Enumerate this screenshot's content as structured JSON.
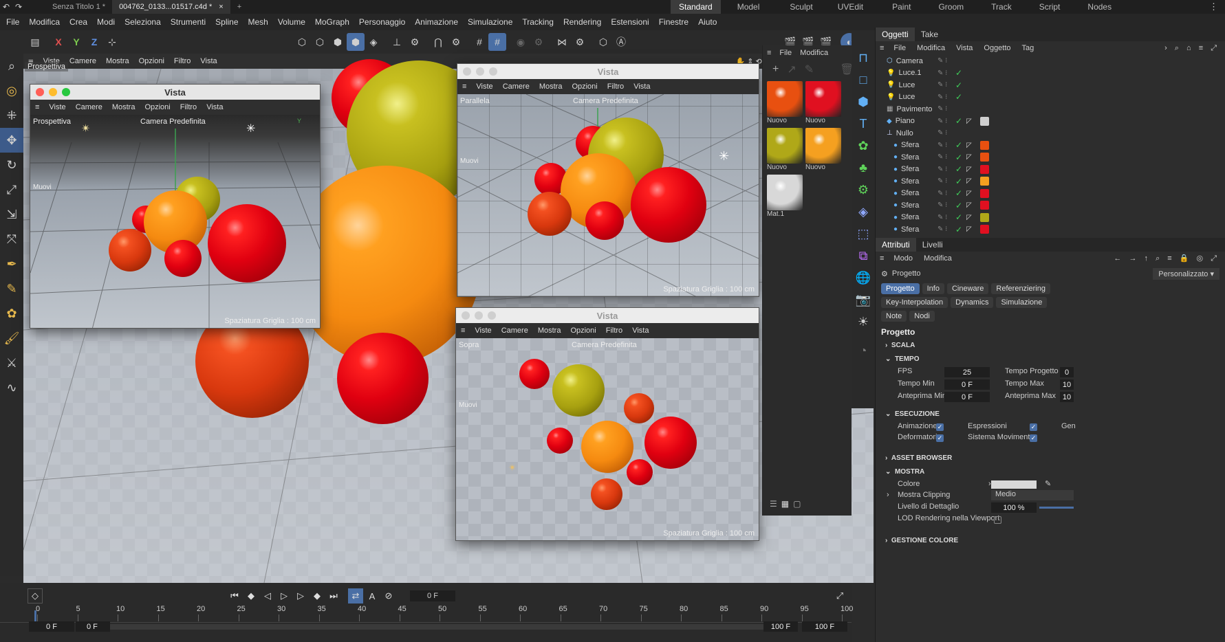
{
  "tabs": {
    "doc1": "Senza Titolo 1 *",
    "doc2": "004762_0133...01517.c4d *",
    "layouts": [
      "Standard",
      "Model",
      "Sculpt",
      "UVEdit",
      "Paint",
      "Groom",
      "Track",
      "Script",
      "Nodes"
    ],
    "active_layout": "Standard"
  },
  "menu": [
    "File",
    "Modifica",
    "Crea",
    "Modi",
    "Seleziona",
    "Strumenti",
    "Spline",
    "Mesh",
    "Volume",
    "MoGraph",
    "Personaggio",
    "Animazione",
    "Simulazione",
    "Tracking",
    "Rendering",
    "Estensioni",
    "Finestre",
    "Aiuto"
  ],
  "toolbar": {
    "x": "X",
    "y": "Y",
    "z": "Z"
  },
  "viewport_menu": [
    "Viste",
    "Camere",
    "Mostra",
    "Opzioni",
    "Filtro",
    "Vista"
  ],
  "main_viewport": {
    "label": "Prospettiva",
    "grid": "Spaziatura Griglia : 100 cm"
  },
  "win1": {
    "title": "Vista",
    "view": "Prospettiva",
    "camera": "Camera Predefinita",
    "move": "Muovi",
    "grid": "Spaziatura Griglia : 100 cm"
  },
  "win2": {
    "title": "Vista",
    "view": "Parallela",
    "camera": "Camera Predefinita",
    "move": "Muovi",
    "grid": "Spaziatura Griglia : 100 cm"
  },
  "win3": {
    "title": "Vista",
    "view": "Sopra",
    "camera": "Camera Predefinita",
    "move": "Muovi",
    "grid": "Spaziatura Griglia : 100 cm"
  },
  "materials": {
    "menu": [
      "File",
      "Modifica"
    ],
    "items": [
      "Nuovo",
      "Nuovo",
      "Nuovo",
      "Nuovo",
      "Mat.1"
    ],
    "colors": [
      "#e85010",
      "#e01020",
      "#b0a818",
      "#f5a020",
      "#d8d8d8"
    ]
  },
  "objects": {
    "tabs": [
      "Oggetti",
      "Take"
    ],
    "menu": [
      "File",
      "Modifica",
      "Vista",
      "Oggetto",
      "Tag"
    ],
    "rows": [
      {
        "name": "Camera",
        "check": false,
        "tag": ""
      },
      {
        "name": "Luce.1",
        "check": true,
        "tag": ""
      },
      {
        "name": "Luce",
        "check": true,
        "tag": ""
      },
      {
        "name": "Luce",
        "check": true,
        "tag": ""
      },
      {
        "name": "Pavimento",
        "check": false,
        "tag": ""
      },
      {
        "name": "Piano",
        "check": true,
        "tag": "#cfcfcf"
      },
      {
        "name": "Nullo",
        "check": false,
        "tag": ""
      },
      {
        "name": "Sfera",
        "check": true,
        "tag": "#e85010"
      },
      {
        "name": "Sfera",
        "check": true,
        "tag": "#e85010"
      },
      {
        "name": "Sfera",
        "check": true,
        "tag": "#e01020"
      },
      {
        "name": "Sfera",
        "check": true,
        "tag": "#f5a020"
      },
      {
        "name": "Sfera",
        "check": true,
        "tag": "#e01020"
      },
      {
        "name": "Sfera",
        "check": true,
        "tag": "#e01020"
      },
      {
        "name": "Sfera",
        "check": true,
        "tag": "#b0a818"
      },
      {
        "name": "Sfera",
        "check": true,
        "tag": "#e01020"
      }
    ]
  },
  "attributes": {
    "tabs": [
      "Attributi",
      "Livelli"
    ],
    "menu": [
      "Modo",
      "Modifica"
    ],
    "project": "Progetto",
    "preset": "Personalizzato",
    "buttons_row1": [
      "Progetto",
      "Info",
      "Cineware",
      "Referenziering"
    ],
    "buttons_row2": [
      "Key-Interpolation",
      "Dynamics",
      "Simulazione",
      "Note"
    ],
    "buttons_row3": [
      "Nodi"
    ],
    "heading": "Progetto",
    "sections": {
      "scala": "SCALA",
      "tempo": "TEMPO",
      "esecuzione": "ESECUZIONE",
      "asset": "ASSET BROWSER",
      "mostra": "MOSTRA",
      "gestione": "GESTIONE COLORE"
    },
    "tempo": {
      "fps_label": "FPS",
      "fps": "25",
      "tmin_label": "Tempo Min",
      "tmin": "0 F",
      "amin_label": "Anteprima Min",
      "amin": "0 F",
      "tprog_label": "Tempo Progetto",
      "tprog": "0",
      "tmax_label": "Tempo Max",
      "tmax": "10",
      "amax_label": "Anteprima Max",
      "amax": "10"
    },
    "esecuzione": {
      "animazione": "Animazione",
      "deformatori": "Deformatori",
      "espressioni": "Espressioni",
      "sistema": "Sistema Movimento",
      "gen": "Gen"
    },
    "mostra": {
      "colore": "Colore",
      "clipping": "Mostra Clipping",
      "clipping_val": "Medio",
      "dettaglio": "Livello di Dettaglio",
      "dettaglio_val": "100 %",
      "lod": "LOD Rendering nella Viewport"
    }
  },
  "timeline": {
    "current_frame": "0 F",
    "ticks": [
      "0",
      "5",
      "10",
      "15",
      "20",
      "25",
      "30",
      "35",
      "40",
      "45",
      "50",
      "55",
      "60",
      "65",
      "70",
      "75",
      "80",
      "85",
      "90",
      "95",
      "100"
    ],
    "start": "0 F",
    "start2": "0 F",
    "end": "100 F",
    "end2": "100 F"
  }
}
